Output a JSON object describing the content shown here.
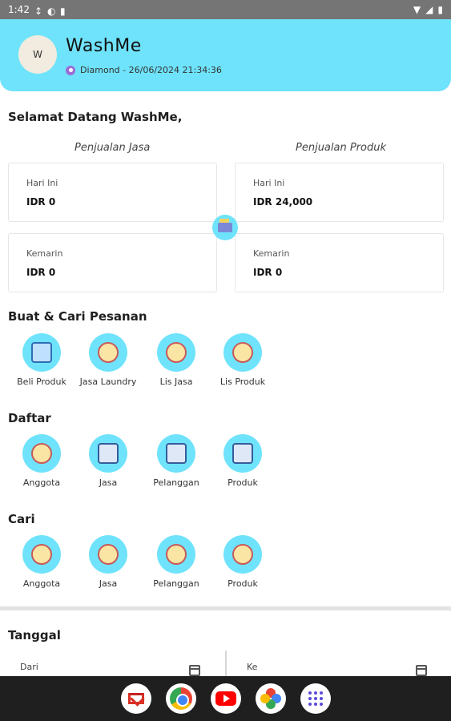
{
  "status_bar": {
    "time": "1:42"
  },
  "header": {
    "avatar_initial": "W",
    "app_name": "WashMe",
    "subscription": "Diamond - 26/06/2024 21:34:36"
  },
  "welcome": "Selamat Datang WashMe,",
  "sales": {
    "service_title": "Penjualan Jasa",
    "product_title": "Penjualan Produk",
    "service_today_label": "Hari Ini",
    "service_today_value": "IDR 0",
    "service_yesterday_label": "Kemarin",
    "service_yesterday_value": "IDR 0",
    "product_today_label": "Hari Ini",
    "product_today_value": "IDR 24,000",
    "product_yesterday_label": "Kemarin",
    "product_yesterday_value": "IDR 0"
  },
  "orders": {
    "title": "Buat & Cari Pesanan",
    "items": [
      "Beli Produk",
      "Jasa Laundry",
      "Lis Jasa",
      "Lis Produk"
    ]
  },
  "daftar": {
    "title": "Daftar",
    "items": [
      "Anggota",
      "Jasa",
      "Pelanggan",
      "Produk"
    ]
  },
  "cari": {
    "title": "Cari",
    "items": [
      "Anggota",
      "Jasa",
      "Pelanggan",
      "Produk"
    ]
  },
  "tanggal": {
    "title": "Tanggal",
    "from_label": "Dari",
    "to_label": "Ke"
  },
  "colors": {
    "accent": "#6fe3fb",
    "badge": "#9c6bd6"
  },
  "dock": {
    "apps": [
      "gmail-icon",
      "chrome-icon",
      "youtube-icon",
      "photos-icon",
      "app-drawer-icon"
    ]
  }
}
